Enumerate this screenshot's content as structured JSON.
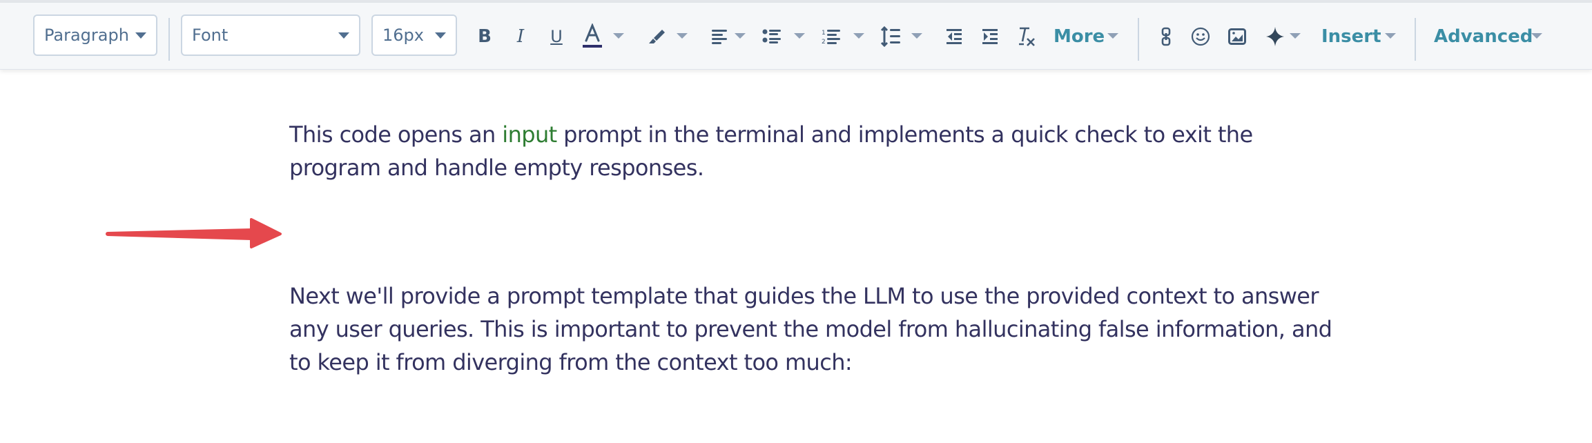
{
  "toolbar": {
    "block_format": "Paragraph",
    "font": "Font",
    "font_size": "16px",
    "more_label": "More",
    "insert_label": "Insert",
    "advanced_label": "Advanced",
    "icons": [
      "bold-icon",
      "italic-icon",
      "underline-icon",
      "text-color-icon",
      "highlight-icon",
      "align-icon",
      "bulleted-list-icon",
      "numbered-list-icon",
      "line-height-icon",
      "outdent-icon",
      "indent-icon",
      "clear-format-icon",
      "link-icon",
      "emoji-icon",
      "image-icon",
      "ai-sparkle-icon"
    ],
    "colors": {
      "accent": "#3b8ea5",
      "icon": "#425b76",
      "text_color_underline": "#2d2e6b"
    }
  },
  "document": {
    "paragraph1": {
      "before": "This code opens an ",
      "code_word": "input",
      "after_line1": " prompt in the terminal and implements a quick check to exit the",
      "line2": "program and handle empty responses."
    },
    "annotation": "red-arrow",
    "paragraph2": {
      "line1": "Next we'll provide a prompt template that guides the LLM to use the provided context to answer",
      "line2": "any user queries. This is important to prevent the model from hallucinating false information, and",
      "line3": "to keep it from diverging from the context too much:"
    },
    "colors": {
      "text": "#33325f",
      "code": "#2e7d32",
      "arrow": "#e5484d"
    }
  }
}
